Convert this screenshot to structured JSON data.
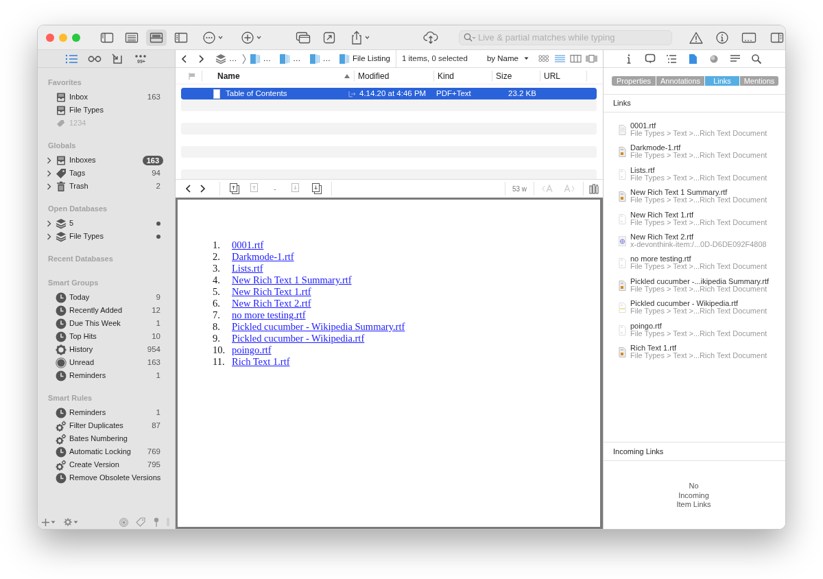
{
  "toolbar": {
    "layouts": [
      {
        "kind": "sidebar",
        "selected": false
      },
      {
        "kind": "list",
        "selected": false
      },
      {
        "kind": "split",
        "selected": true
      },
      {
        "kind": "widescreen",
        "selected": false
      }
    ],
    "search": {
      "placeholder": "Live & partial matches while typing"
    }
  },
  "sidebar": {
    "modes": [
      {
        "kind": "list",
        "selected": true
      },
      {
        "kind": "reading",
        "selected": false
      },
      {
        "kind": "import",
        "selected": false
      },
      {
        "kind": "more",
        "selected": false,
        "badge": "99+"
      }
    ],
    "sections": [
      {
        "title": "Favorites",
        "items": [
          {
            "kind": "inbox",
            "label": "Inbox",
            "count": "163",
            "disabled": false
          },
          {
            "kind": "inbox",
            "label": "File Types",
            "disabled": false
          },
          {
            "kind": "tags",
            "label": "1234",
            "disabled": true
          }
        ]
      },
      {
        "title": "Globals",
        "items": [
          {
            "kind": "inbox",
            "label": "Inboxes",
            "count": "163",
            "highlighted": true,
            "expanded": false
          },
          {
            "kind": "tag",
            "label": "Tags",
            "count": "94",
            "highlighted": false,
            "expanded": false
          },
          {
            "kind": "trash",
            "label": "Trash",
            "count": "2",
            "highlighted": false,
            "expanded": false
          }
        ]
      },
      {
        "title": "Open Databases",
        "items": [
          {
            "kind": "database",
            "label": "5",
            "marked": true,
            "expanded": false
          },
          {
            "kind": "database",
            "label": "File Types",
            "marked": true,
            "expanded": false
          }
        ]
      },
      {
        "title": "Recent Databases"
      },
      {
        "title": "Smart Groups",
        "items": [
          {
            "kind": "clock",
            "label": "Today",
            "count": "9"
          },
          {
            "kind": "clock",
            "label": "Recently Added",
            "count": "12"
          },
          {
            "kind": "clock",
            "label": "Due This Week",
            "count": "1"
          },
          {
            "kind": "clock",
            "label": "Top Hits",
            "count": "10"
          },
          {
            "kind": "gear",
            "label": "History",
            "count": "954"
          },
          {
            "kind": "unread",
            "label": "Unread",
            "count": "163"
          },
          {
            "kind": "clock",
            "label": "Reminders",
            "count": "1"
          }
        ]
      },
      {
        "title": "Smart Rules",
        "items": [
          {
            "kind": "clock",
            "label": "Reminders",
            "count": "1"
          },
          {
            "kind": "gears",
            "label": "Filter Duplicates",
            "count": "87"
          },
          {
            "kind": "gears",
            "label": "Bates Numbering"
          },
          {
            "kind": "clock",
            "label": "Automatic Locking",
            "count": "769"
          },
          {
            "kind": "gears",
            "label": "Create Version",
            "count": "795"
          },
          {
            "kind": "clock",
            "label": "Remove Obsolete Versions"
          }
        ]
      }
    ]
  },
  "browser": {
    "path": [
      {
        "kind": "database",
        "label": "…"
      },
      {
        "kind": "group",
        "label": "…"
      },
      {
        "kind": "group",
        "label": "…"
      },
      {
        "kind": "group",
        "label": "…"
      },
      {
        "kind": "group",
        "label": "File Listing"
      }
    ],
    "status": "1 items, 0 selected",
    "sort": "by Name",
    "views": [
      {
        "kind": "icons",
        "selected": false
      },
      {
        "kind": "list",
        "selected": true
      },
      {
        "kind": "columns",
        "selected": false
      },
      {
        "kind": "cover",
        "selected": false
      }
    ],
    "table": {
      "columns": [
        {
          "label": "Name",
          "sorted": true
        },
        {
          "label": "Modified",
          "sorted": false
        },
        {
          "label": "Kind",
          "sorted": false
        },
        {
          "label": "Size",
          "sorted": false
        },
        {
          "label": "URL",
          "sorted": false
        }
      ],
      "rows": [
        {
          "name": "Table of Contents",
          "modified": "4.14.20 at 4:46 PM",
          "kind": "PDF+Text",
          "size": "23.2 KB",
          "selected": true
        }
      ]
    }
  },
  "editor": {
    "word_count": "53 w",
    "page_marker": "-",
    "document": [
      {
        "number": "1.",
        "title": "0001.rtf"
      },
      {
        "number": "2.",
        "title": "Darkmode-1.rtf"
      },
      {
        "number": "3.",
        "title": "Lists.rtf"
      },
      {
        "number": "4.",
        "title": "New Rich Text 1 Summary.rtf"
      },
      {
        "number": "5.",
        "title": "New Rich Text 1.rtf"
      },
      {
        "number": "6.",
        "title": "New Rich Text 2.rtf"
      },
      {
        "number": "7.",
        "title": "no more testing.rtf"
      },
      {
        "number": "8.",
        "title": "Pickled cucumber - Wikipedia Summary.rtf"
      },
      {
        "number": "9.",
        "title": "Pickled cucumber - Wikipedia.rtf"
      },
      {
        "number": "10.",
        "title": "poingo.rtf"
      },
      {
        "number": "11.",
        "title": "Rich Text 1.rtf"
      }
    ]
  },
  "inspector": {
    "tabs": [
      {
        "kind": "info",
        "selected": false
      },
      {
        "kind": "annotation",
        "selected": false
      },
      {
        "kind": "outline",
        "selected": false
      },
      {
        "kind": "document",
        "selected": true
      },
      {
        "kind": "concordance",
        "selected": false
      },
      {
        "kind": "text",
        "selected": false
      },
      {
        "kind": "search",
        "selected": false
      }
    ],
    "segments": [
      {
        "label": "Properties",
        "selected": false
      },
      {
        "label": "Annotations",
        "selected": false
      },
      {
        "label": "Links",
        "selected": true
      },
      {
        "label": "Mentions",
        "selected": false
      }
    ],
    "links_title": "Links",
    "links": [
      {
        "kind": "blank",
        "name": "0001.rtf",
        "path": "File Types > Text >...Rich Text Document"
      },
      {
        "kind": "rich",
        "name": "Darkmode-1.rtf",
        "path": "File Types > Text >...Rich Text Document"
      },
      {
        "kind": "text",
        "name": "Lists.rtf",
        "path": "File Types > Text >...Rich Text Document"
      },
      {
        "kind": "rich",
        "name": "New Rich Text 1 Summary.rtf",
        "path": "File Types > Text >...Rich Text Document"
      },
      {
        "kind": "text",
        "name": "New Rich Text 1.rtf",
        "path": "File Types > Text >...Rich Text Document"
      },
      {
        "kind": "url",
        "name": "New Rich Text 2.rtf",
        "path": "x-devonthink-item:/...0D-D6DE092F4808"
      },
      {
        "kind": "text",
        "name": "no more testing.rtf",
        "path": "File Types > Text >...Rich Text Document"
      },
      {
        "kind": "rich",
        "name": "Pickled cucumber -...ikipedia Summary.rtf",
        "path": "File Types > Text >...Rich Text Document"
      },
      {
        "kind": "note",
        "name": "Pickled cucumber - Wikipedia.rtf",
        "path": "File Types > Text >...Rich Text Document"
      },
      {
        "kind": "text",
        "name": "poingo.rtf",
        "path": "File Types > Text >...Rich Text Document"
      },
      {
        "kind": "rich",
        "name": "Rich Text 1.rtf",
        "path": "File Types > Text >...Rich Text Document"
      }
    ],
    "incoming_title": "Incoming Links",
    "incoming_empty": "No\nIncoming\nItem Links"
  }
}
